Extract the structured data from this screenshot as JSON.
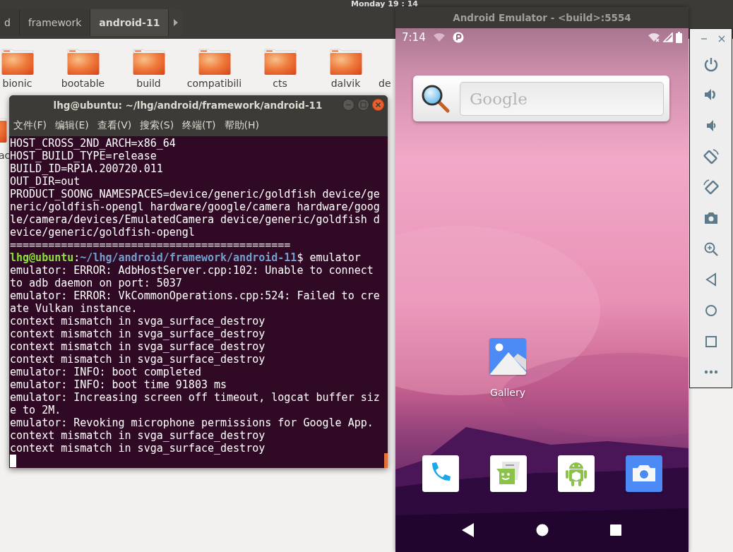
{
  "top_bar": {
    "clock": "Monday 19 : 14"
  },
  "file_manager": {
    "path": [
      {
        "label": "d",
        "selected": false
      },
      {
        "label": "framework",
        "selected": false
      },
      {
        "label": "android-11",
        "selected": true
      }
    ],
    "folders": [
      {
        "name": "bionic"
      },
      {
        "name": "bootable"
      },
      {
        "name": "build"
      },
      {
        "name": "compatibili"
      },
      {
        "name": "cts"
      },
      {
        "name": "dalvik"
      },
      {
        "name": "de"
      }
    ],
    "second_row_label": "ac"
  },
  "terminal": {
    "title": "lhg@ubuntu: ~/lhg/android/framework/android-11",
    "menu": [
      "文件(F)",
      "编辑(E)",
      "查看(V)",
      "搜索(S)",
      "终端(T)",
      "帮助(H)"
    ],
    "lines": [
      {
        "kind": "output",
        "text": "HOST_CROSS_2ND_ARCH=x86_64"
      },
      {
        "kind": "output",
        "text": "HOST_BUILD_TYPE=release"
      },
      {
        "kind": "output",
        "text": "BUILD_ID=RP1A.200720.011"
      },
      {
        "kind": "output",
        "text": "OUT_DIR=out"
      },
      {
        "kind": "output",
        "text": "PRODUCT_SOONG_NAMESPACES=device/generic/goldfish device/ge"
      },
      {
        "kind": "output",
        "text": "neric/goldfish-opengl hardware/google/camera hardware/goog"
      },
      {
        "kind": "output",
        "text": "le/camera/devices/EmulatedCamera device/generic/goldfish d"
      },
      {
        "kind": "output",
        "text": "evice/generic/goldfish-opengl"
      },
      {
        "kind": "output",
        "text": "============================================"
      },
      {
        "kind": "prompt",
        "user": "lhg@ubuntu",
        "separator": ":",
        "path": "~/lhg/android/framework/android-11",
        "command": "$ emulator"
      },
      {
        "kind": "output",
        "text": "emulator: ERROR: AdbHostServer.cpp:102: Unable to connect"
      },
      {
        "kind": "output",
        "text": "to adb daemon on port: 5037"
      },
      {
        "kind": "output",
        "text": "emulator: ERROR: VkCommonOperations.cpp:524: Failed to cre"
      },
      {
        "kind": "output",
        "text": "ate Vulkan instance."
      },
      {
        "kind": "output",
        "text": "context mismatch in svga_surface_destroy"
      },
      {
        "kind": "output",
        "text": "context mismatch in svga_surface_destroy"
      },
      {
        "kind": "output",
        "text": "context mismatch in svga_surface_destroy"
      },
      {
        "kind": "output",
        "text": "context mismatch in svga_surface_destroy"
      },
      {
        "kind": "output",
        "text": "emulator: INFO: boot completed"
      },
      {
        "kind": "output",
        "text": "emulator: INFO: boot time 91803 ms"
      },
      {
        "kind": "output",
        "text": "emulator: Increasing screen off timeout, logcat buffer siz"
      },
      {
        "kind": "output",
        "text": "e to 2M."
      },
      {
        "kind": "output",
        "text": "emulator: Revoking microphone permissions for Google App."
      },
      {
        "kind": "output",
        "text": "context mismatch in svga_surface_destroy"
      },
      {
        "kind": "output",
        "text": "context mismatch in svga_surface_destroy"
      },
      {
        "kind": "cursor"
      }
    ]
  },
  "emulator": {
    "title": "Android Emulator - <build>:5554",
    "status_time": "7:14",
    "search": {
      "placeholder": "Google"
    },
    "home_apps": [
      {
        "label": "Gallery"
      }
    ]
  }
}
